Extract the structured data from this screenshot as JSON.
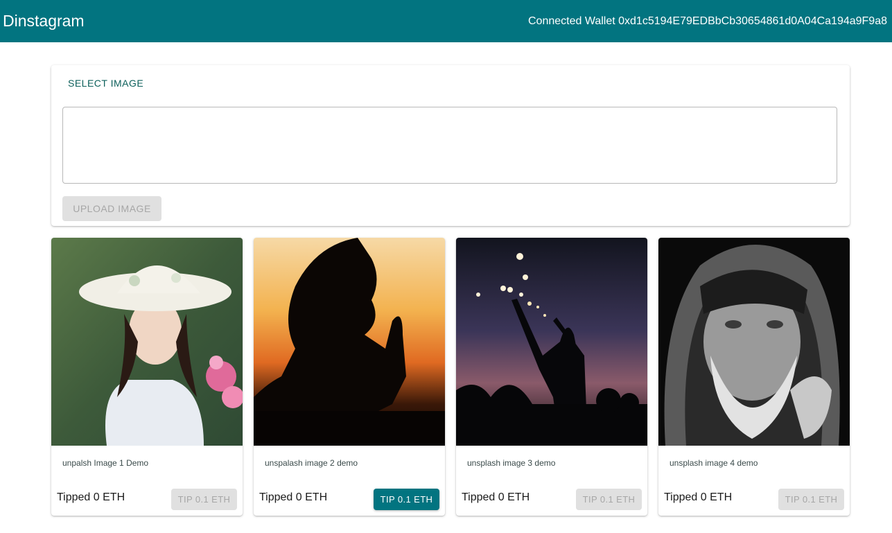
{
  "header": {
    "title": "Dinstagram",
    "wallet_label": "Connected Wallet 0xd1c5194E79EDBbCb30654861d0A04Ca194a9F9a8"
  },
  "upload": {
    "select_label": "SELECT IMAGE",
    "description_value": "",
    "upload_label": "UPLOAD IMAGE"
  },
  "posts": [
    {
      "caption": "unpalsh Image 1 Demo",
      "tipped": "Tipped 0 ETH",
      "tip_label": "TIP 0.1 ETH",
      "tip_enabled": false
    },
    {
      "caption": "unspalash image 2 demo",
      "tipped": "Tipped 0 ETH",
      "tip_label": "TIP 0.1 ETH",
      "tip_enabled": true
    },
    {
      "caption": "unsplash image 3 demo",
      "tipped": "Tipped 0 ETH",
      "tip_label": "TIP 0.1 ETH",
      "tip_enabled": false
    },
    {
      "caption": "unsplash image 4 demo",
      "tipped": "Tipped 0 ETH",
      "tip_label": "TIP 0.1 ETH",
      "tip_enabled": false
    }
  ],
  "colors": {
    "primary": "#027480",
    "disabled_bg": "#e0e0e0",
    "disabled_text": "#a6a6a6",
    "select_text": "#0b5f5a"
  }
}
